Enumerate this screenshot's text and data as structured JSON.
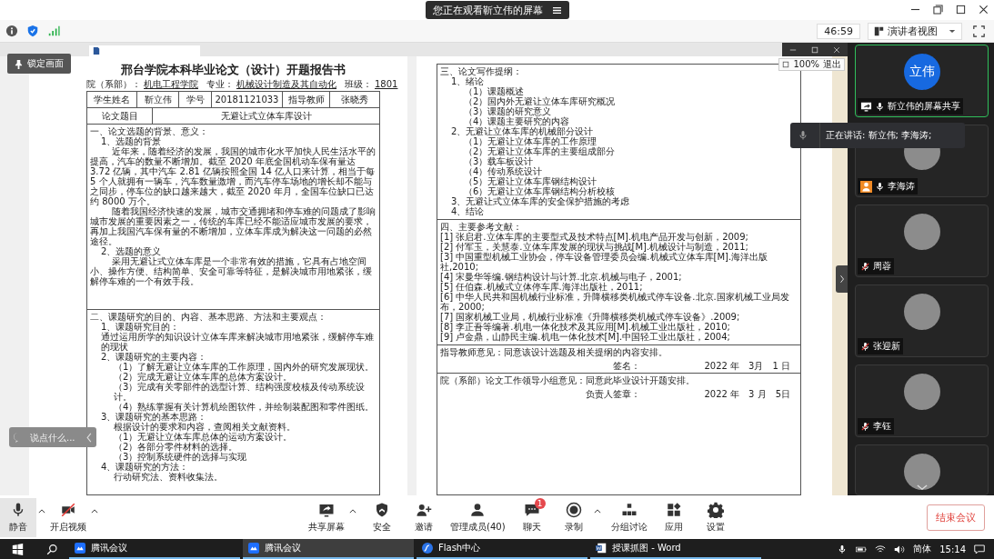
{
  "notice": {
    "text": "您正在观看靳立伟的屏幕"
  },
  "timer": "46:59",
  "view_button": "演讲者视图",
  "document": {
    "left_page": {
      "title": "邢台学院本科毕业论文（设计）开题报告书",
      "fields": [
        {
          "label": "院（系部）：",
          "value": "机电工程学院"
        },
        {
          "label": "专业：",
          "value": "机械设计制造及其自动化"
        },
        {
          "label": "班级：",
          "value": "1801"
        }
      ],
      "info_row": [
        "学生姓名",
        "靳立伟",
        "学号",
        "20181121033",
        "指导教师",
        "张晓秀"
      ],
      "topic_row": [
        "论文题目",
        "无避让式立体车库设计"
      ],
      "sections": [
        {
          "lines": [
            {
              "kind": "heading",
              "text": "一、论文选题的背景、意义："
            },
            {
              "kind": "sub",
              "text": "1、选题的背景"
            },
            {
              "kind": "para",
              "text": "近年来，随着经济的发展，我国的城市化水平加快人民生活水平的提高，汽车的数量不断增加。截至 2020 年底全国机动车保有量达 3.72 亿辆，其中汽车 2.81 亿辆按照全国 14 亿人口来计算，相当于每 5 个人就拥有一辆车，汽车数量激增，而汽车停车场地的增长却不能与之同步，停车位的缺口越来越大，截至 2020 年月，全国车位缺口已达约 8000 万个。"
            },
            {
              "kind": "para",
              "text": "随着我国经济快速的发展，城市交通拥堵和停车难的问题成了影响城市发展的重要因素之一，传统的车库已经不能适应城市发展的要求，再加上我国汽车保有量的不断增加，立体车库成为解决这一问题的必然途径。"
            },
            {
              "kind": "sub",
              "text": "2、选题的意义"
            },
            {
              "kind": "para",
              "text": "采用无避让式立体车库是一个非常有效的措施，它具有占地空间小、操作方便、结构简单、安全可靠等特征，是解决城市用地紧张，缓解停车难的一个有效手段。"
            }
          ]
        },
        {
          "lines": [
            {
              "kind": "heading",
              "text": "二、课题研究的目的、内容、基本思路、方法和主要观点："
            },
            {
              "kind": "sub",
              "text": "1、课题研究目的："
            },
            {
              "kind": "sub",
              "text": "通过运用所学的知识设计立体车库来解决城市用地紧张，缓解停车难的现状"
            },
            {
              "kind": "sub",
              "text": "2、课题研究的主要内容："
            },
            {
              "kind": "item",
              "text": "（1）了解无避让立体车库的工作原理，国内外的研究发展现状。"
            },
            {
              "kind": "item",
              "text": "（2）完成无避让立体车库的总体方案设计。"
            },
            {
              "kind": "item",
              "text": "（3）完成有关零部件的选型计算、结构强度校核及传动系统设计。"
            },
            {
              "kind": "item",
              "text": "（4）熟练掌握有关计算机绘图软件，并绘制装配图和零件图纸。"
            },
            {
              "kind": "sub",
              "text": "3、课题研究的基本思路："
            },
            {
              "kind": "item",
              "text": "根据设计的要求和内容，查阅相关文献资料。"
            },
            {
              "kind": "item",
              "text": "（1）无避让立体车库总体的运动方案设计。"
            },
            {
              "kind": "item",
              "text": "（2）各部分零件材料的选择。"
            },
            {
              "kind": "item",
              "text": "（3）控制系统硬件的选择与实现"
            },
            {
              "kind": "sub",
              "text": "4、课题研究的方法："
            },
            {
              "kind": "item",
              "text": "行动研究法、资料收集法。"
            }
          ]
        }
      ]
    },
    "right_page": {
      "zoom": {
        "value": "100%",
        "exit": "退出"
      },
      "sections": [
        {
          "lines": [
            {
              "kind": "heading",
              "text": "三、论文写作提纲："
            },
            {
              "kind": "sub",
              "text": "1、绪论"
            },
            {
              "kind": "item",
              "text": "（1）课题概述"
            },
            {
              "kind": "item",
              "text": "（2）国内外无避让立体车库研究概况"
            },
            {
              "kind": "item",
              "text": "（3）课题的研究意义"
            },
            {
              "kind": "item",
              "text": "（4）课题主要研究的内容"
            },
            {
              "kind": "sub",
              "text": "2、无避让立体车库的机械部分设计"
            },
            {
              "kind": "item",
              "text": "（1）无避让立体车库的工作原理"
            },
            {
              "kind": "item",
              "text": "（2）无避让立体车库的主要组成部分"
            },
            {
              "kind": "item",
              "text": "（3）载车板设计"
            },
            {
              "kind": "item",
              "text": "（4）传动系统设计"
            },
            {
              "kind": "item",
              "text": "（5）无避让立体车库钢结构设计"
            },
            {
              "kind": "item",
              "text": "（6）无避让立体车库钢结构分析校核"
            },
            {
              "kind": "sub",
              "text": "3、无避让式立体车库的安全保护措施的考虑"
            },
            {
              "kind": "sub",
              "text": "4、结论"
            }
          ]
        },
        {
          "lines": [
            {
              "kind": "heading",
              "text": "四、主要参考文献："
            },
            {
              "kind": "ref",
              "text": "[1] 张启君.立体车库的主要型式及技术特点[M].机电产品开发与创新，2009;"
            },
            {
              "kind": "ref",
              "text": "[2] 付军玉，关慧泰.立体车库发展的现状与挑战[M].机械设计与制造，2011;"
            },
            {
              "kind": "ref",
              "text": "[3] 中国重型机械工业协会，停车设备管理委员会编.机械式立体车库[M].海洋出版社,2010;"
            },
            {
              "kind": "ref",
              "text": "[4] 宋曼华等编.钢结构设计与计算.北京.机械与电子，2001;"
            },
            {
              "kind": "ref",
              "text": "[5] 任伯森.机械式立体停车库.海洋出版社，2011;"
            },
            {
              "kind": "ref",
              "text": "[6] 中华人民共和国机械行业标准，升降横移类机械式停车设备.北京.国家机械工业局发布，2000;"
            },
            {
              "kind": "ref",
              "text": "[7] 国家机械工业局，机械行业标准《升降横移类机械式停车设备》.2009;"
            },
            {
              "kind": "ref",
              "text": "[8] 李正吾等编著.机电一体化技术及其应用[M].机械工业出版社，2010;"
            },
            {
              "kind": "ref",
              "text": "[9] 卢金鼎，山静民主编.机电一体化技术[M].中国轻工业出版社，2004;"
            }
          ]
        }
      ],
      "opinions": [
        {
          "text": "指导教师意见：同意该设计选题及相关提纲的内容安排。",
          "signature": "签名：",
          "date": "2022 年　3月　1 日"
        },
        {
          "text": "院（系部）论文工作领导小组意见：同意此毕业设计开题安排。",
          "signature": "负责人签章：",
          "date": "2022 年　3 月　5日"
        }
      ]
    }
  },
  "overlays": {
    "lock": "锁定画面",
    "chat_placeholder": "说点什么...",
    "speaking": "正在讲话: 靳立伟; 李海涛;"
  },
  "participants": [
    {
      "kind": "initials",
      "name": "靳立伟的屏幕共享",
      "initials": "立伟",
      "sharing": true,
      "person_icon": false,
      "muted": false,
      "selected": true
    },
    {
      "kind": "photo",
      "name": "李海涛",
      "sharing": false,
      "person_icon": true,
      "muted": false,
      "selected": false
    },
    {
      "kind": "photo",
      "name": "周蓉",
      "sharing": false,
      "person_icon": false,
      "muted": true,
      "selected": false
    },
    {
      "kind": "photo",
      "name": "张迎新",
      "sharing": false,
      "person_icon": false,
      "muted": true,
      "selected": false
    },
    {
      "kind": "photo",
      "name": "李钰",
      "sharing": false,
      "person_icon": false,
      "muted": true,
      "selected": false
    },
    {
      "kind": "photo",
      "selected": false
    }
  ],
  "toolbar": {
    "left": [
      {
        "kind": "mic",
        "label": "静音",
        "caret": true,
        "selected": true
      },
      {
        "kind": "camera-off",
        "label": "开启视频",
        "caret": true,
        "selected": false
      }
    ],
    "center": [
      {
        "kind": "share",
        "label": "共享屏幕",
        "caret": true
      },
      {
        "kind": "shield",
        "label": "安全"
      },
      {
        "kind": "invite",
        "label": "邀请"
      },
      {
        "kind": "members",
        "label": "管理成员(40)"
      },
      {
        "kind": "chat",
        "label": "聊天",
        "badge": "1"
      },
      {
        "kind": "record",
        "label": "录制",
        "caret": true
      },
      {
        "kind": "breakout",
        "label": "分组讨论"
      },
      {
        "kind": "apps",
        "label": "应用"
      },
      {
        "kind": "settings",
        "label": "设置"
      }
    ],
    "end_button": "结束会议"
  },
  "taskbar": {
    "apps": [
      {
        "kind": "meeting",
        "label": "腾讯会议",
        "selected": false
      },
      {
        "kind": "meeting",
        "label": "腾讯会议",
        "selected": true
      },
      {
        "kind": "flash",
        "label": "Flash中心",
        "selected": false
      },
      {
        "kind": "word",
        "label": "授课抓图 - Word",
        "selected": false
      }
    ],
    "language": "简体",
    "clock": "15:14"
  }
}
